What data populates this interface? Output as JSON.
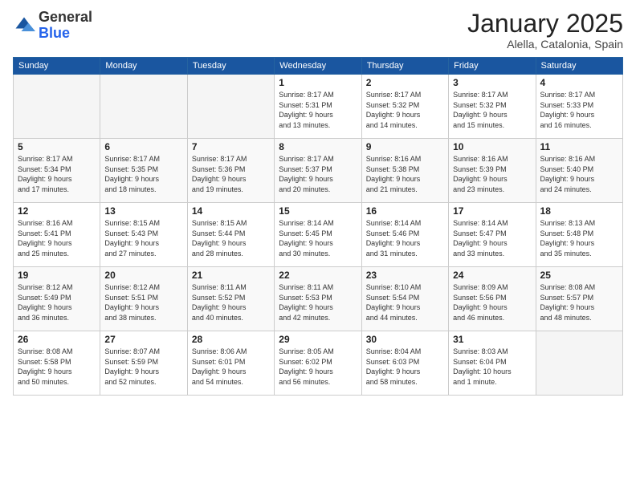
{
  "logo": {
    "general": "General",
    "blue": "Blue"
  },
  "header": {
    "month": "January 2025",
    "location": "Alella, Catalonia, Spain"
  },
  "weekdays": [
    "Sunday",
    "Monday",
    "Tuesday",
    "Wednesday",
    "Thursday",
    "Friday",
    "Saturday"
  ],
  "weeks": [
    [
      {
        "day": "",
        "info": ""
      },
      {
        "day": "",
        "info": ""
      },
      {
        "day": "",
        "info": ""
      },
      {
        "day": "1",
        "info": "Sunrise: 8:17 AM\nSunset: 5:31 PM\nDaylight: 9 hours\nand 13 minutes."
      },
      {
        "day": "2",
        "info": "Sunrise: 8:17 AM\nSunset: 5:32 PM\nDaylight: 9 hours\nand 14 minutes."
      },
      {
        "day": "3",
        "info": "Sunrise: 8:17 AM\nSunset: 5:32 PM\nDaylight: 9 hours\nand 15 minutes."
      },
      {
        "day": "4",
        "info": "Sunrise: 8:17 AM\nSunset: 5:33 PM\nDaylight: 9 hours\nand 16 minutes."
      }
    ],
    [
      {
        "day": "5",
        "info": "Sunrise: 8:17 AM\nSunset: 5:34 PM\nDaylight: 9 hours\nand 17 minutes."
      },
      {
        "day": "6",
        "info": "Sunrise: 8:17 AM\nSunset: 5:35 PM\nDaylight: 9 hours\nand 18 minutes."
      },
      {
        "day": "7",
        "info": "Sunrise: 8:17 AM\nSunset: 5:36 PM\nDaylight: 9 hours\nand 19 minutes."
      },
      {
        "day": "8",
        "info": "Sunrise: 8:17 AM\nSunset: 5:37 PM\nDaylight: 9 hours\nand 20 minutes."
      },
      {
        "day": "9",
        "info": "Sunrise: 8:16 AM\nSunset: 5:38 PM\nDaylight: 9 hours\nand 21 minutes."
      },
      {
        "day": "10",
        "info": "Sunrise: 8:16 AM\nSunset: 5:39 PM\nDaylight: 9 hours\nand 23 minutes."
      },
      {
        "day": "11",
        "info": "Sunrise: 8:16 AM\nSunset: 5:40 PM\nDaylight: 9 hours\nand 24 minutes."
      }
    ],
    [
      {
        "day": "12",
        "info": "Sunrise: 8:16 AM\nSunset: 5:41 PM\nDaylight: 9 hours\nand 25 minutes."
      },
      {
        "day": "13",
        "info": "Sunrise: 8:15 AM\nSunset: 5:43 PM\nDaylight: 9 hours\nand 27 minutes."
      },
      {
        "day": "14",
        "info": "Sunrise: 8:15 AM\nSunset: 5:44 PM\nDaylight: 9 hours\nand 28 minutes."
      },
      {
        "day": "15",
        "info": "Sunrise: 8:14 AM\nSunset: 5:45 PM\nDaylight: 9 hours\nand 30 minutes."
      },
      {
        "day": "16",
        "info": "Sunrise: 8:14 AM\nSunset: 5:46 PM\nDaylight: 9 hours\nand 31 minutes."
      },
      {
        "day": "17",
        "info": "Sunrise: 8:14 AM\nSunset: 5:47 PM\nDaylight: 9 hours\nand 33 minutes."
      },
      {
        "day": "18",
        "info": "Sunrise: 8:13 AM\nSunset: 5:48 PM\nDaylight: 9 hours\nand 35 minutes."
      }
    ],
    [
      {
        "day": "19",
        "info": "Sunrise: 8:12 AM\nSunset: 5:49 PM\nDaylight: 9 hours\nand 36 minutes."
      },
      {
        "day": "20",
        "info": "Sunrise: 8:12 AM\nSunset: 5:51 PM\nDaylight: 9 hours\nand 38 minutes."
      },
      {
        "day": "21",
        "info": "Sunrise: 8:11 AM\nSunset: 5:52 PM\nDaylight: 9 hours\nand 40 minutes."
      },
      {
        "day": "22",
        "info": "Sunrise: 8:11 AM\nSunset: 5:53 PM\nDaylight: 9 hours\nand 42 minutes."
      },
      {
        "day": "23",
        "info": "Sunrise: 8:10 AM\nSunset: 5:54 PM\nDaylight: 9 hours\nand 44 minutes."
      },
      {
        "day": "24",
        "info": "Sunrise: 8:09 AM\nSunset: 5:56 PM\nDaylight: 9 hours\nand 46 minutes."
      },
      {
        "day": "25",
        "info": "Sunrise: 8:08 AM\nSunset: 5:57 PM\nDaylight: 9 hours\nand 48 minutes."
      }
    ],
    [
      {
        "day": "26",
        "info": "Sunrise: 8:08 AM\nSunset: 5:58 PM\nDaylight: 9 hours\nand 50 minutes."
      },
      {
        "day": "27",
        "info": "Sunrise: 8:07 AM\nSunset: 5:59 PM\nDaylight: 9 hours\nand 52 minutes."
      },
      {
        "day": "28",
        "info": "Sunrise: 8:06 AM\nSunset: 6:01 PM\nDaylight: 9 hours\nand 54 minutes."
      },
      {
        "day": "29",
        "info": "Sunrise: 8:05 AM\nSunset: 6:02 PM\nDaylight: 9 hours\nand 56 minutes."
      },
      {
        "day": "30",
        "info": "Sunrise: 8:04 AM\nSunset: 6:03 PM\nDaylight: 9 hours\nand 58 minutes."
      },
      {
        "day": "31",
        "info": "Sunrise: 8:03 AM\nSunset: 6:04 PM\nDaylight: 10 hours\nand 1 minute."
      },
      {
        "day": "",
        "info": ""
      }
    ]
  ]
}
